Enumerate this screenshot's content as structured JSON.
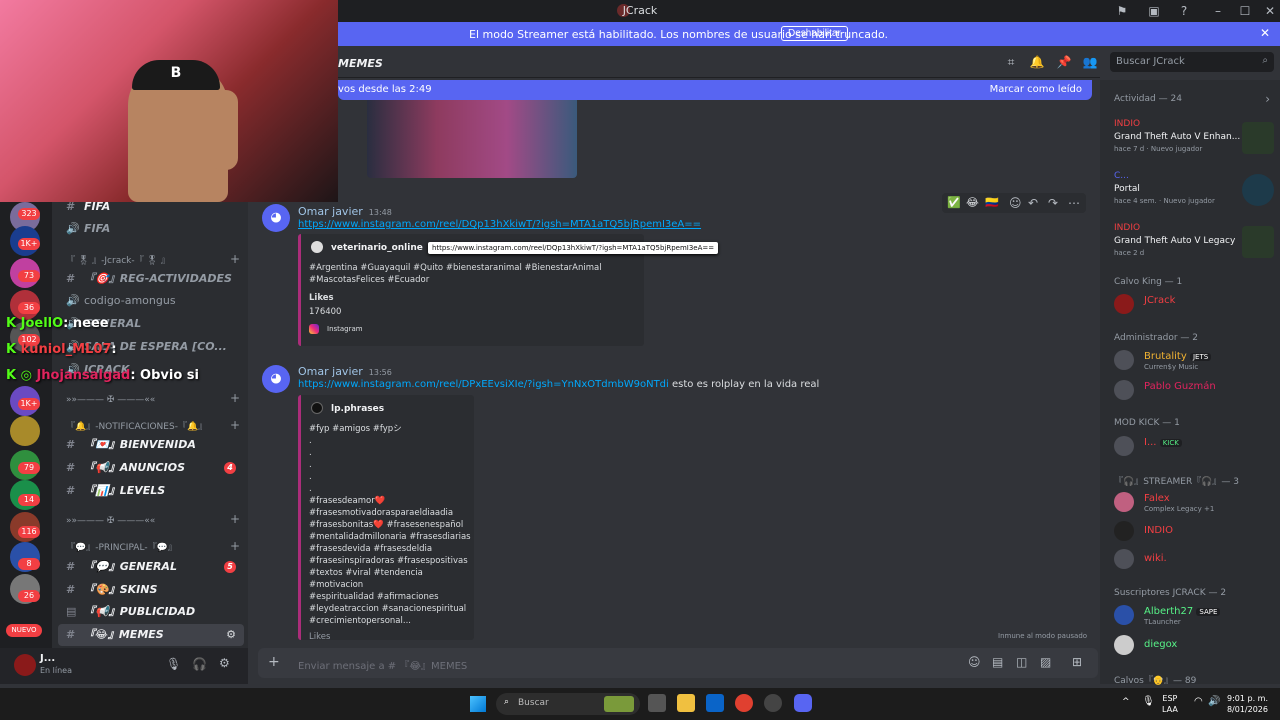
{
  "window": {
    "title": "JCrack"
  },
  "banner": {
    "text": "El modo Streamer está habilitado. Los nombres de usuario se han truncado.",
    "button": "Deshabilitar"
  },
  "header": {
    "channel": "MEMES",
    "search_placeholder": "Buscar JCrack"
  },
  "new_messages": {
    "left": "vos desde las 2:49",
    "right": "Marcar como leído"
  },
  "server_badges": [
    "323",
    "1K+",
    "73",
    "36",
    "102",
    "1K+",
    "79",
    "14",
    "116",
    "8",
    "26"
  ],
  "server_new_label": "NUEVO",
  "channels": [
    {
      "name": "FIFA",
      "type": "hash",
      "bold": true
    },
    {
      "name": "FIFA",
      "type": "voice",
      "bold": false
    },
    {
      "name": "『 🎖 』-Jcrack-『 🎖 』",
      "type": "category"
    },
    {
      "name": "『🎯』REG-ACTIVIDADES",
      "type": "hash",
      "bold": false
    },
    {
      "name": "codigo-amongus",
      "type": "voice",
      "bold": false
    },
    {
      "name": "GENERAL",
      "type": "voice",
      "bold": false
    },
    {
      "name": "SALA DE ESPERA [CO...",
      "type": "voice",
      "bold": false
    },
    {
      "name": "JCRACK",
      "type": "voice",
      "bold": false
    },
    {
      "name": "»»——— ✠ ———««",
      "type": "category"
    },
    {
      "name": "『🔔』-NOTIFICACIONES-『🔔』",
      "type": "category"
    },
    {
      "name": "『💌』BIENVENIDA",
      "type": "hash",
      "bold": true
    },
    {
      "name": "『📢』ANUNCIOS",
      "type": "hash",
      "bold": true,
      "badge": "4"
    },
    {
      "name": "『📊』LEVELS",
      "type": "hash",
      "bold": true
    },
    {
      "name": "»»——— ✠ ———««",
      "type": "category"
    },
    {
      "name": "『💬』-PRINCIPAL-『💬』",
      "type": "category"
    },
    {
      "name": "『💬』GENERAL",
      "type": "hash",
      "bold": true,
      "badge": "5"
    },
    {
      "name": "『🎨』SKINS",
      "type": "hash",
      "bold": true
    },
    {
      "name": "『📢』PUBLICIDAD",
      "type": "hash",
      "bold": true
    },
    {
      "name": "『😂』MEMES",
      "type": "hash",
      "bold": true
    }
  ],
  "user": {
    "name": "J...",
    "status": "En línea"
  },
  "overlay_chat": [
    {
      "user": "JoellO",
      "text": ": neee"
    },
    {
      "user": "kuniol_ML07",
      "text": ":"
    },
    {
      "user": "Jhojansalgad",
      "text": ": Obvio si"
    }
  ],
  "messages": [
    {
      "author": "Omar javier",
      "time": "13:48",
      "link": "https://www.instagram.com/reel/DQp13hXkiwT/?igsh=MTA1aTQ5bjRpemI3eA==",
      "embed": {
        "site": "veterinario_online",
        "desc": "#Argentina #Guayaquil #Quito #bienestaranimal #BienestarAnimal #MascotasFelices #Ecuador",
        "field_name": "Likes",
        "field_value": "176400",
        "footer": "Instagram"
      }
    },
    {
      "author": "Omar javier",
      "time": "13:56",
      "link": "https://www.instagram.com/reel/DPxEEvsiXIe/?igsh=YnNxOTdmbW9oNTdi",
      "text": " esto es rolplay en la vida real",
      "embed": {
        "site": "lp.phrases",
        "desc_lines": [
          "#fyp #amigos #fypシ",
          ".",
          ".",
          ".",
          ".",
          ".",
          "#frasesdeamor❤️",
          "#frasesmotivadorasparaeldiaadia",
          "#frasesbonitas❤️ #frasesenespañol",
          "#mentalidadmillonaria #frasesdiarias",
          "#frasesdevida #frasesdeldia",
          "#frasesinspiradoras #frasespositivas",
          "#textos #viral #tendencia #motivacion",
          "#espiritualidad #afirmaciones",
          "#leydeatraccion #sanacionespiritual",
          "#crecimientopersonal..."
        ],
        "field_name": "Likes"
      }
    }
  ],
  "tooltip": "https://www.instagram.com/reel/DQp13hXkiwT/?igsh=MTA1aTQ5bjRpemI3eA==",
  "pause_note": "Inmune al modo pausado",
  "composer_placeholder": "Enviar mensaje a # 『😂』MEMES",
  "members": {
    "activity_header": "Actividad — 24",
    "activities": [
      {
        "user": "INDIO",
        "game": "Grand Theft Auto V Enhan...",
        "meta": "hace 7 d",
        "tag": "Nuevo jugador"
      },
      {
        "user": "C...",
        "game": "Portal",
        "meta": "hace 4 sem.",
        "tag": "Nuevo jugador"
      },
      {
        "user": "INDIO",
        "game": "Grand Theft Auto V Legacy",
        "meta": "hace 2 d",
        "tag": ""
      }
    ],
    "groups": [
      {
        "title": "Calvo King — 1",
        "members": [
          {
            "name": "JCrack",
            "color": "#f23f43",
            "sub": ""
          }
        ]
      },
      {
        "title": "Administrador — 2",
        "members": [
          {
            "name": "Brutality",
            "color": "#f0b232",
            "sub": "Curren$y Music",
            "tag": "JETS"
          },
          {
            "name": "Pablo Guzmán",
            "color": "#e0245e",
            "sub": ""
          }
        ]
      },
      {
        "title": "MOD KICK — 1",
        "members": [
          {
            "name": "I...",
            "color": "#f23f43",
            "sub": "",
            "tag": "KICK"
          }
        ]
      },
      {
        "title": "『🎧』STREAMER『🎧』— 3",
        "members": [
          {
            "name": "Falex",
            "color": "#f23f43",
            "sub": "Complex Legacy +1"
          },
          {
            "name": "INDIO",
            "color": "#f23f43",
            "sub": ""
          },
          {
            "name": "wiki.",
            "color": "#f23f43",
            "sub": ""
          }
        ]
      },
      {
        "title": "Suscriptores JCRACK — 2",
        "members": [
          {
            "name": "Alberth27",
            "color": "#57f287",
            "sub": "TLauncher",
            "tag": "SAPE"
          },
          {
            "name": "diegox",
            "color": "#57f287",
            "sub": ""
          }
        ]
      },
      {
        "title": "Calvos『👴』— 89",
        "members": []
      }
    ]
  },
  "taskbar": {
    "search": "Buscar",
    "lang1": "ESP",
    "lang2": "LAA",
    "time": "9:01 p. m.",
    "date": "8/01/2026"
  }
}
